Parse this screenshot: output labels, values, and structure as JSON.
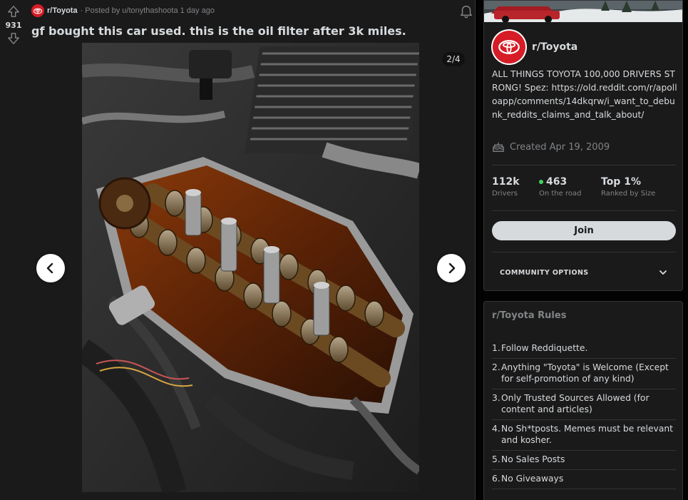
{
  "post": {
    "vote_count": "931",
    "subreddit": "r/Toyota",
    "posted_by": "· Posted by u/tonythashoota 1 day ago",
    "title": "gf bought this car used. this is the oil filter after 3k miles.",
    "gallery_counter": "2/4"
  },
  "sidebar": {
    "community_name": "r/Toyota",
    "description": "ALL THINGS TOYOTA 100,000 DRIVERS STRONG! Spez: https://old.reddit.com/r/apolloapp/comments/14dkqrw/i_want_to_debunk_reddits_claims_and_talk_about/",
    "created": "Created Apr 19, 2009",
    "stats": [
      {
        "value": "112k",
        "label": "Drivers"
      },
      {
        "value": "463",
        "label": "On the road"
      },
      {
        "value": "Top 1%",
        "label": "Ranked by Size"
      }
    ],
    "join_label": "Join",
    "community_options": "COMMUNITY OPTIONS"
  },
  "rules": {
    "title": "r/Toyota Rules",
    "items": [
      {
        "n": "1.",
        "text": "Follow Reddiquette."
      },
      {
        "n": "2.",
        "text": "Anything \"Toyota\" is Welcome (Except for self-promotion of any kind)"
      },
      {
        "n": "3.",
        "text": "Only Trusted Sources Allowed (for content and articles)"
      },
      {
        "n": "4.",
        "text": "No Sh*tposts. Memes must be relevant and kosher."
      },
      {
        "n": "5.",
        "text": "No Sales Posts"
      },
      {
        "n": "6.",
        "text": "No Giveaways"
      }
    ]
  },
  "colors": {
    "brand_red": "#d61c26",
    "online_green": "#46d160",
    "background": "#1a1a1b"
  }
}
